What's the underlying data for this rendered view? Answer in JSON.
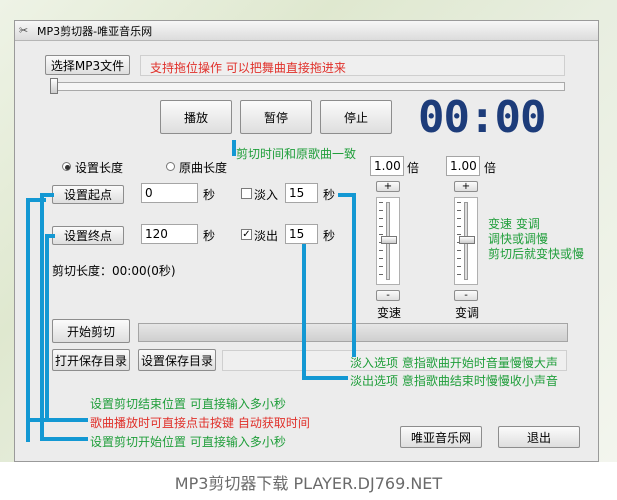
{
  "window": {
    "title": "MP3剪切器-唯亚音乐网"
  },
  "buttons": {
    "select_file": "选择MP3文件",
    "play": "播放",
    "pause": "暂停",
    "stop": "停止",
    "set_start": "设置起点",
    "set_end": "设置终点",
    "start_cut": "开始剪切",
    "open_save_dir": "打开保存目录",
    "set_save_dir": "设置保存目录",
    "weiya": "唯亚音乐网",
    "exit": "退出"
  },
  "hint_drag": "支持拖位操作  可以把舞曲直接拖进来",
  "timer": "00:00",
  "radios": {
    "set_length": "设置长度",
    "original_length": "原曲长度",
    "selected": "set_length"
  },
  "start_field": {
    "value": "0",
    "unit": "秒"
  },
  "end_field": {
    "value": "120",
    "unit": "秒"
  },
  "fade_in": {
    "label": "淡入",
    "checked": false,
    "value": "15",
    "unit": "秒"
  },
  "fade_out": {
    "label": "淡出",
    "checked": true,
    "value": "15",
    "unit": "秒"
  },
  "cut_length": "剪切长度：00:00(0秒)",
  "speed": {
    "value": "1.00",
    "unit": "倍",
    "plus": "+",
    "minus": "-",
    "label": "变速"
  },
  "pitch": {
    "value": "1.00",
    "unit": "倍",
    "plus": "+",
    "minus": "-",
    "label": "变调"
  },
  "annotations": {
    "same_length": "剪切时间和原歌曲一致",
    "speed_line1": "变速 变调",
    "speed_line2": "调快或调慢",
    "speed_line3": "剪切后就变快或慢",
    "fade_in_note": "淡入选项   意指歌曲开始时音量慢慢大声",
    "fade_out_note": "淡出选项   意指歌曲结束时慢慢收小声音",
    "end_note": "设置剪切结束位置    可直接输入多小秒",
    "playing_note": "歌曲播放时可直接点击按键  自动获取时间",
    "start_note": "设置剪切开始位置    可直接输入多小秒"
  },
  "footer": "MP3剪切器下载    PLAYER.DJ769.NET",
  "colors": {
    "accent_blue": "#1398d3",
    "note_green": "#1f9e3a",
    "note_red": "#e0302a",
    "timer": "#1d3c7a"
  }
}
